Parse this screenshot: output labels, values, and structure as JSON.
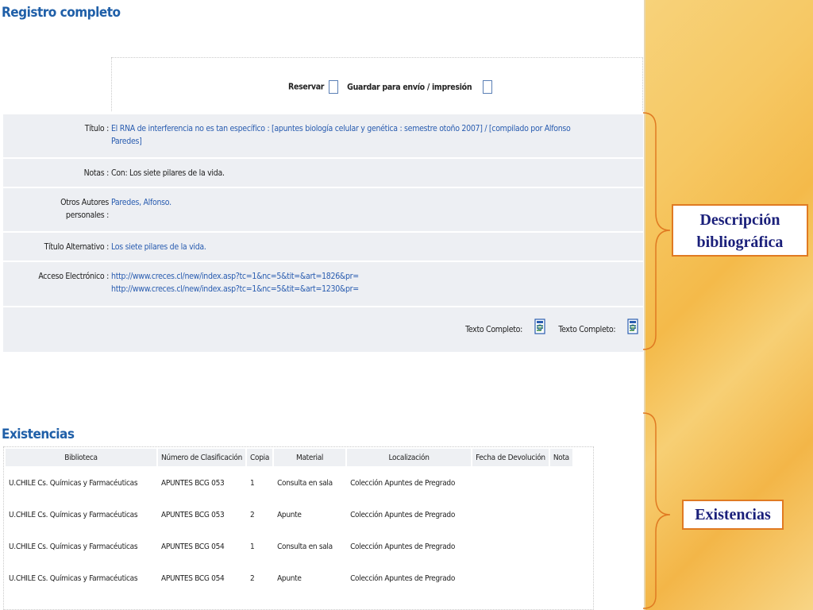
{
  "header": {
    "title": "Registro completo"
  },
  "reserve": {
    "reserve_label": "Reservar",
    "save_label": "Guardar para envío / impresión"
  },
  "fields": [
    {
      "label": "Título :",
      "value_line1": "El RNA de interferencia no es tan específico : [apuntes biología celular y genética : semestre otoño 2007] / [compilado por Alfonso",
      "value_line2": "Paredes]"
    },
    {
      "label": "Notas :",
      "value": "Con: Los siete pilares de la vida."
    },
    {
      "label_line1": "Otros Autores",
      "label_line2": "personales :",
      "value": "Paredes, Alfonso."
    },
    {
      "label": "Título Alternativo :",
      "value": "Los siete pilares de la vida."
    },
    {
      "label": "Acceso Electrónico :",
      "value_line1": "http://www.creces.cl/new/index.asp?tc=1&nc=5&tit=&art=1826&pr=",
      "value_line2": "http://www.creces.cl/new/index.asp?tc=1&nc=5&tit=&art=1230&pr="
    }
  ],
  "fulltext": {
    "label1": "Texto Completo:",
    "label2": "Texto Completo:"
  },
  "holdings": {
    "title": "Existencias",
    "headers": [
      "Biblioteca",
      "Número de Clasificación",
      "Copia",
      "Material",
      "Localización",
      "Fecha de Devolución",
      "Nota"
    ],
    "rows": [
      [
        "U.CHILE Cs. Químicas y Farmacéuticas",
        "APUNTES BCG 053",
        "1",
        "Consulta en sala",
        "Colección Apuntes de Pregrado",
        "",
        ""
      ],
      [
        "U.CHILE Cs. Químicas y Farmacéuticas",
        "APUNTES BCG 053",
        "2",
        "Apunte",
        "Colección Apuntes de Pregrado",
        "",
        ""
      ],
      [
        "U.CHILE Cs. Químicas y Farmacéuticas",
        "APUNTES BCG 054",
        "1",
        "Consulta en sala",
        "Colección Apuntes de Pregrado",
        "",
        ""
      ],
      [
        "U.CHILE Cs. Químicas y Farmacéuticas",
        "APUNTES BCG 054",
        "2",
        "Apunte",
        "Colección Apuntes de Pregrado",
        "",
        ""
      ]
    ]
  },
  "annotations": {
    "desc_line1": "Descripción",
    "desc_line2": "bibliográfica",
    "exist": "Existencias"
  },
  "colors": {
    "accent_orange": "#e07a22",
    "callout_text": "#1a1f7a",
    "link_blue": "#2a5db0"
  }
}
